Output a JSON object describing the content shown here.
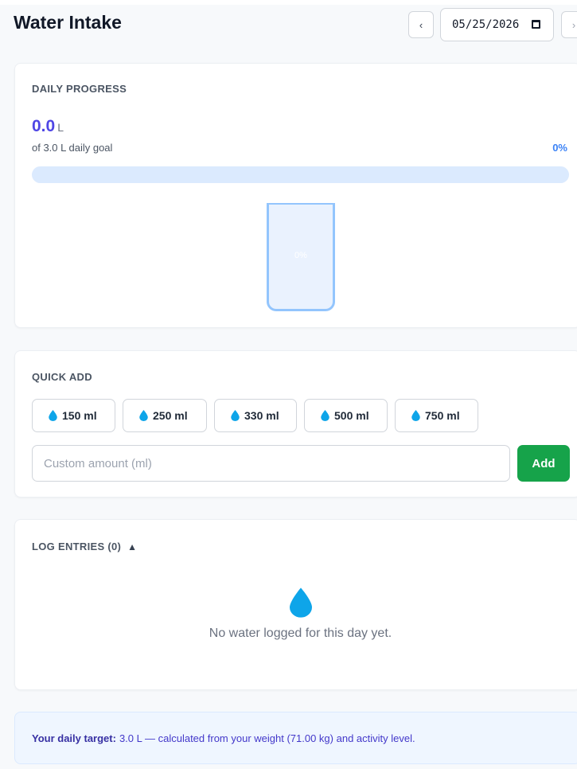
{
  "header": {
    "title": "Water Intake",
    "prev_label": "‹",
    "next_label": "›",
    "date_value": "05/25/2026"
  },
  "progress": {
    "section_label": "DAILY PROGRESS",
    "amount": "0.0",
    "unit": "L",
    "goal_text": "of 3.0 L daily goal",
    "percent_text": "0%",
    "percent": 0,
    "glass_label": "0%"
  },
  "quick_add": {
    "section_label": "QUICK ADD",
    "buttons": [
      "150 ml",
      "250 ml",
      "330 ml",
      "500 ml",
      "750 ml"
    ],
    "custom_placeholder": "Custom amount (ml)",
    "add_label": "Add"
  },
  "log": {
    "section_label": "LOG ENTRIES (0)",
    "caret": "▲",
    "empty_text": "No water logged for this day yet."
  },
  "target": {
    "label": "Your daily target:",
    "text": "3.0 L — calculated from your weight (71.00 kg) and activity level."
  },
  "colors": {
    "accent": "#4f46e5",
    "progress_blue": "#3b82f6",
    "add_green": "#16a34a",
    "drop_blue": "#0ea5e9"
  }
}
